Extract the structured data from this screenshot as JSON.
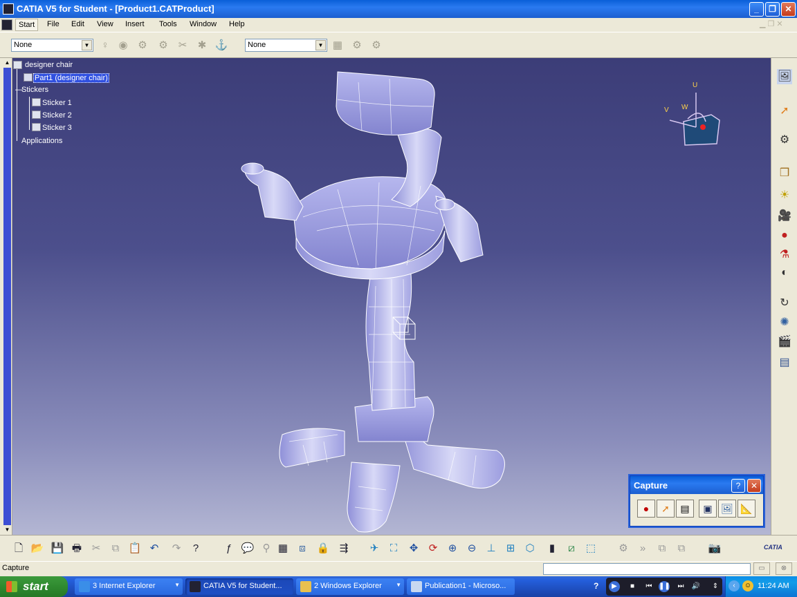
{
  "window": {
    "title": "CATIA V5 for Student - [Product1.CATProduct]",
    "min": "_",
    "restore": "❐",
    "close": "✕"
  },
  "menu": {
    "items": [
      "Start",
      "File",
      "Edit",
      "View",
      "Insert",
      "Tools",
      "Window",
      "Help"
    ]
  },
  "toolbar": {
    "combo1_value": "None",
    "combo2_value": "None"
  },
  "tree": {
    "root": "designer chair",
    "part": "Part1 (designer chair)",
    "stickers": "Stickers",
    "sticker_items": [
      "Sticker 1",
      "Sticker 2",
      "Sticker 3"
    ],
    "applications": "Applications"
  },
  "compass": {
    "u": "U",
    "v": "V",
    "w": "W"
  },
  "capture_panel": {
    "title": "Capture",
    "help": "?",
    "close": "✕"
  },
  "status": {
    "text": "Capture"
  },
  "taskbar": {
    "start": "start",
    "tasks": [
      "3 Internet Explorer",
      "CATIA V5 for Student...",
      "2 Windows Explorer",
      "Publication1 - Microso..."
    ],
    "clock": "11:24 AM"
  },
  "brand": {
    "logo_text": "CATIA"
  }
}
